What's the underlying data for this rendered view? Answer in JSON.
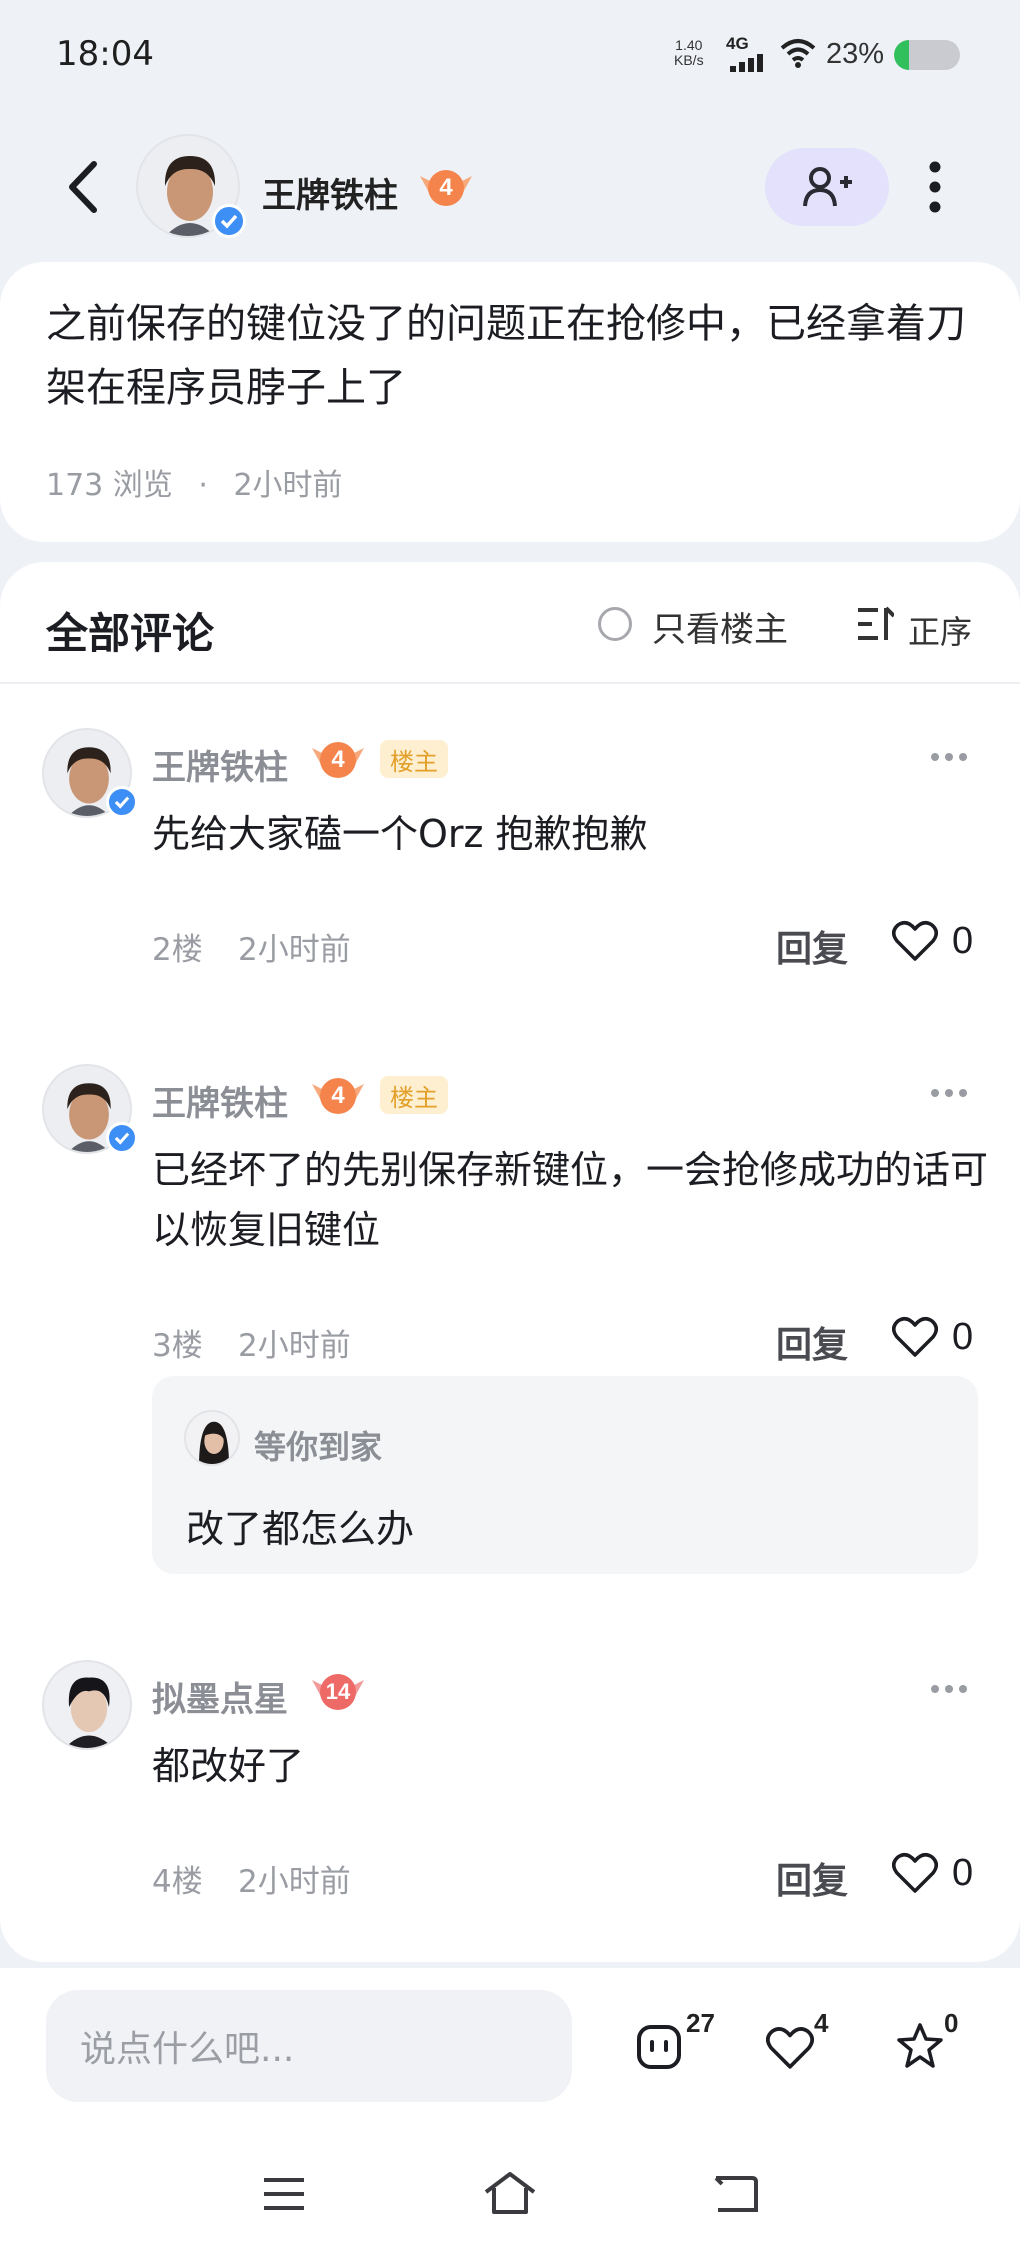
{
  "status_bar": {
    "time": "18:04",
    "net_speed_value": "1.40",
    "net_speed_unit": "KB/s",
    "network": "4G",
    "battery_percent": "23%",
    "battery_level": 0.23
  },
  "header": {
    "author_name": "王牌铁柱",
    "author_level": "4",
    "back_icon": "chevron-left-icon",
    "follow_icon": "add-user-icon",
    "more_icon": "more-vertical-icon"
  },
  "post": {
    "text": "之前保存的键位没了的问题正在抢修中，已经拿着刀架在程序员脖子上了",
    "views": "173 浏览",
    "time": "2小时前"
  },
  "comments_section": {
    "title": "全部评论",
    "only_op_label": "只看楼主",
    "sort_label": "正序",
    "reply_label": "回复",
    "op_tag": "楼主"
  },
  "comments": [
    {
      "name": "王牌铁柱",
      "level": "4",
      "is_op": true,
      "text": "先给大家磕一个Orz 抱歉抱歉",
      "floor": "2楼",
      "time": "2小时前",
      "likes": "0"
    },
    {
      "name": "王牌铁柱",
      "level": "4",
      "is_op": true,
      "text": "已经坏了的先别保存新键位，一会抢修成功的话可以恢复旧键位",
      "floor": "3楼",
      "time": "2小时前",
      "likes": "0",
      "reply": {
        "name": "等你到家",
        "text": "改了都怎么办"
      }
    },
    {
      "name": "拟墨点星",
      "level": "14",
      "is_op": false,
      "text": "都改好了",
      "floor": "4楼",
      "time": "2小时前",
      "likes": "0"
    }
  ],
  "bottom_bar": {
    "input_placeholder": "说点什么吧...",
    "comment_count": "27",
    "like_count": "4",
    "favorite_count": "0"
  },
  "nav_bar": {
    "menu_icon": "menu-icon",
    "home_icon": "home-icon",
    "back_icon": "back-icon"
  },
  "colors": {
    "page_bg": "#eef1f6",
    "accent_follow": "#e3e1fb",
    "level_badge": "#f5844c",
    "op_tag_bg": "#fdefcf",
    "op_tag_text": "#e3a02b",
    "verified": "#3d8ef5",
    "battery": "#31c05c"
  }
}
